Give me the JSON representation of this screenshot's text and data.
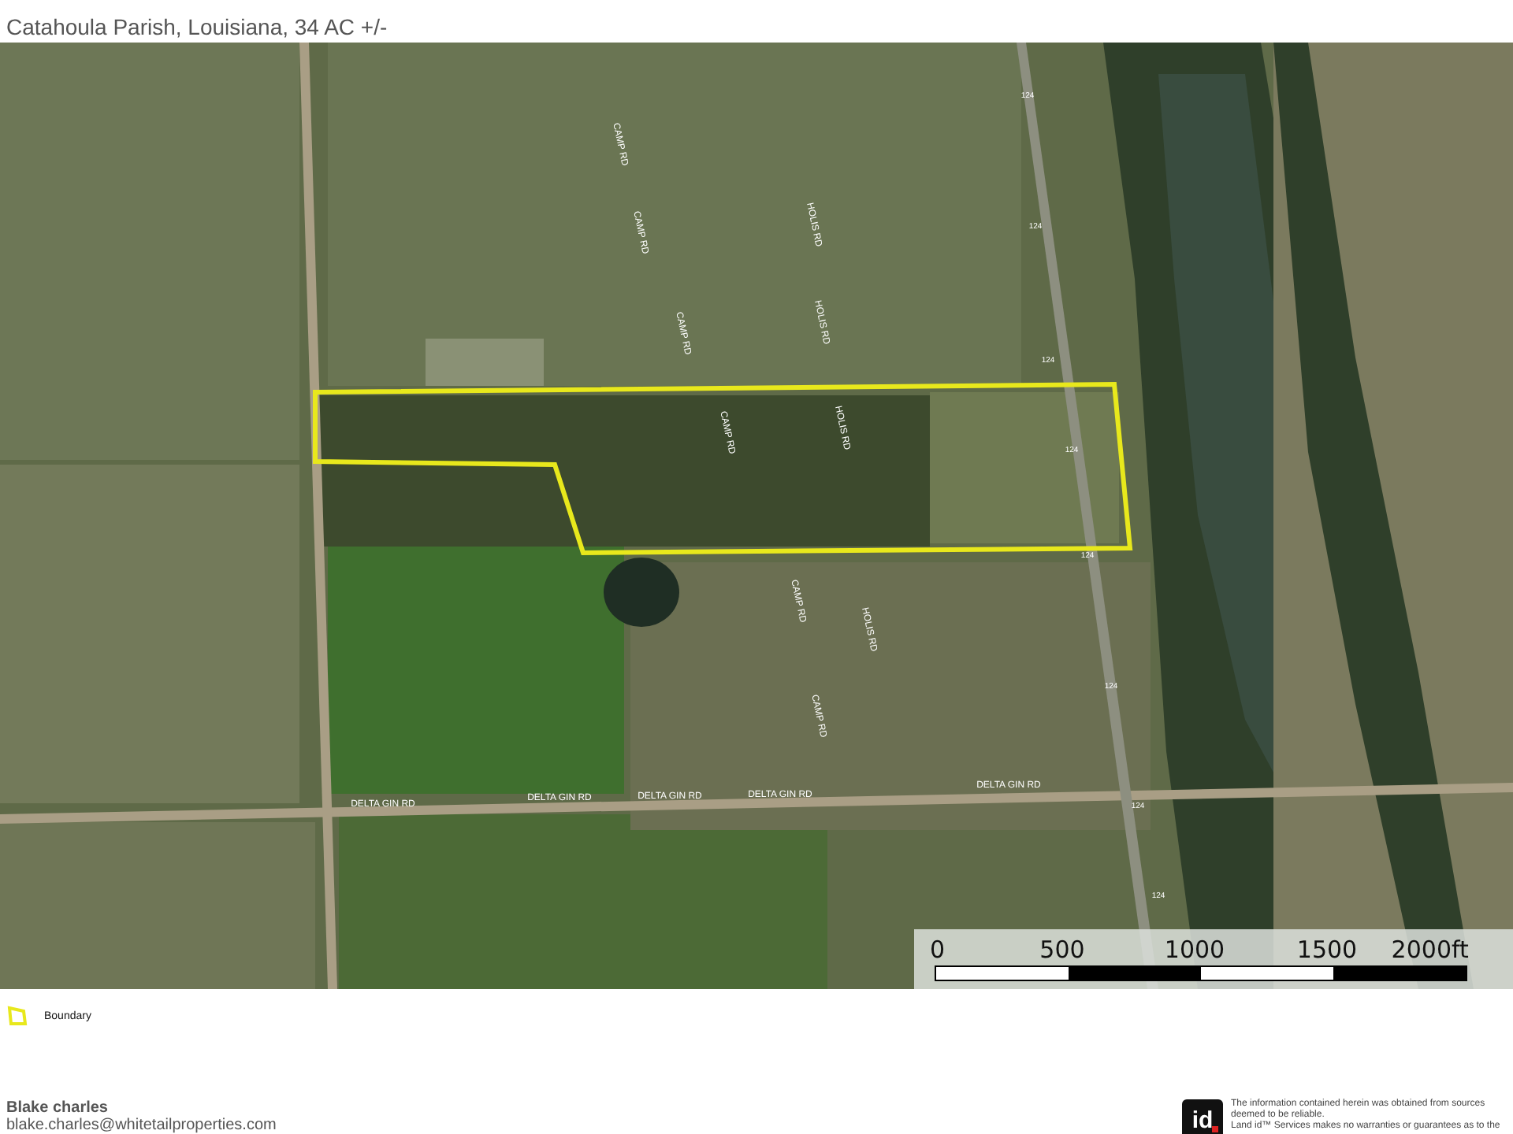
{
  "header": {
    "subtitle": "Catahoula Parish, Louisiana, 34 AC +/-"
  },
  "map": {
    "road_labels": [
      {
        "kind": "vertical",
        "text": "CAMP RD"
      },
      {
        "kind": "vertical",
        "text": "CAMP RD"
      },
      {
        "kind": "vertical",
        "text": "CAMP RD"
      },
      {
        "kind": "vertical",
        "text": "CAMP RD"
      },
      {
        "kind": "vertical",
        "text": "CAMP RD"
      },
      {
        "kind": "vertical",
        "text": "CAMP RD"
      },
      {
        "kind": "vertical",
        "text": "HOLIS RD"
      },
      {
        "kind": "vertical",
        "text": "HOLIS RD"
      },
      {
        "kind": "vertical",
        "text": "HOLIS RD"
      },
      {
        "kind": "vertical",
        "text": "HOLIS RD"
      },
      {
        "kind": "horizontal",
        "text": "DELTA GIN RD"
      },
      {
        "kind": "horizontal",
        "text": "DELTA GIN RD"
      },
      {
        "kind": "horizontal",
        "text": "DELTA GIN RD"
      },
      {
        "kind": "horizontal",
        "text": "DELTA GIN RD"
      },
      {
        "kind": "horizontal",
        "text": "DELTA GIN RD"
      },
      {
        "kind": "shield",
        "text": "124"
      },
      {
        "kind": "shield",
        "text": "124"
      },
      {
        "kind": "shield",
        "text": "124"
      },
      {
        "kind": "shield",
        "text": "124"
      },
      {
        "kind": "shield",
        "text": "124"
      },
      {
        "kind": "shield",
        "text": "124"
      },
      {
        "kind": "shield",
        "text": "124"
      },
      {
        "kind": "shield",
        "text": "124"
      }
    ],
    "scale_bar": {
      "ticks": [
        "0",
        "500",
        "1000",
        "1500",
        "2000ft"
      ]
    }
  },
  "legend": [
    {
      "label": "Boundary",
      "color": "#e8e81c"
    }
  ],
  "footer": {
    "agent_name": "Blake charles",
    "agent_email": "blake.charles@whitetailproperties.com",
    "logo_text": "id",
    "disclaimer": [
      "The information contained herein was obtained from sources",
      "deemed to be reliable.",
      "Land id™ Services makes no warranties or guarantees as to the"
    ]
  }
}
